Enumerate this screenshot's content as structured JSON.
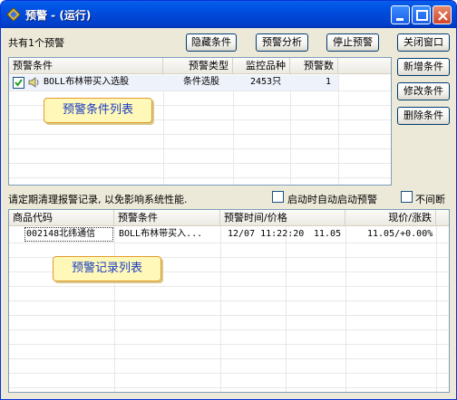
{
  "window": {
    "title": "预警 - (运行)"
  },
  "summary": "共有1个预警",
  "toolbar": {
    "hide_cond": "隐藏条件",
    "analyze": "预警分析",
    "stop": "停止预警",
    "close": "关闭窗口"
  },
  "side_buttons": {
    "add": "新增条件",
    "edit": "修改条件",
    "delete": "删除条件"
  },
  "conditions": {
    "headers": [
      "预警条件",
      "预警类型",
      "监控品种",
      "预警数"
    ],
    "rows": [
      {
        "name": "BOLL布林带买入选股",
        "type": "条件选股",
        "count_items": "2453只",
        "alerts": "1",
        "checked": true
      }
    ],
    "callout": "预警条件列表"
  },
  "notice": "请定期清理报警记录, 以免影响系统性能.",
  "options": {
    "auto_start": "启动时自动启动预警",
    "no_interrupt": "不间断"
  },
  "records": {
    "headers": [
      "商品代码",
      "预警条件",
      "预警时间/价格",
      "现价/涨跌"
    ],
    "rows": [
      {
        "code": "002148北纬通信",
        "cond": "BOLL布林带买入...",
        "time": "12/07 11:22:20",
        "price": "11.05",
        "now": "11.05/+0.00%"
      }
    ],
    "callout": "预警记录列表"
  },
  "colors": {
    "titlebar": "#0055e5",
    "callout_bg": "#fff8b8",
    "callout_text": "#1a3cc4"
  }
}
